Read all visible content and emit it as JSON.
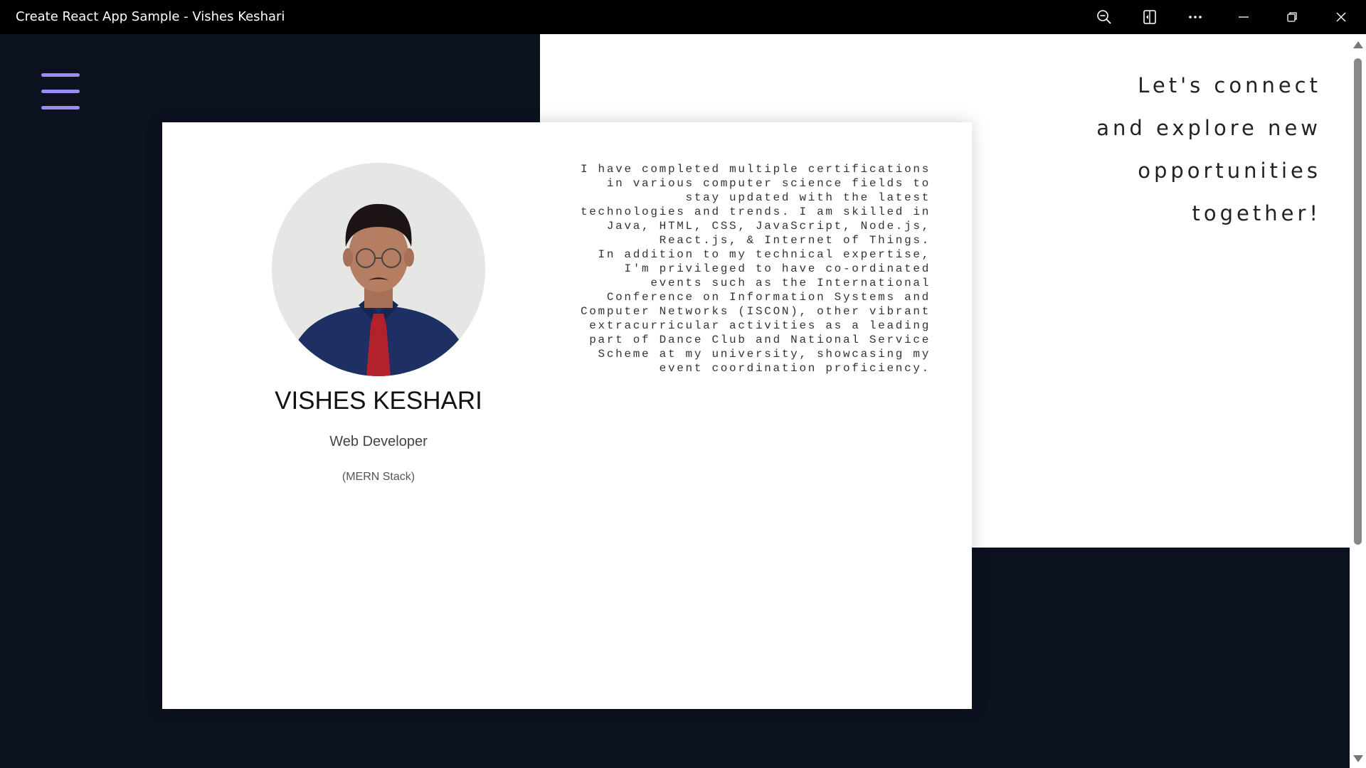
{
  "window": {
    "title": "Create React App Sample - Vishes Keshari",
    "controls": [
      "zoom-out-icon",
      "immersive-reader-icon",
      "more-icon",
      "minimize-icon",
      "restore-icon",
      "close-icon"
    ]
  },
  "nav": {
    "menu_icon": "hamburger-icon",
    "accent_color": "#9b8cf2"
  },
  "connect": {
    "lines": [
      "Let's connect",
      "and explore new",
      "opportunities",
      "together!"
    ]
  },
  "profile": {
    "name": "VISHES KESHARI",
    "role": "Web Developer",
    "stack": "(MERN Stack)",
    "bio": [
      "I have completed multiple certifications in various computer science fields to stay updated with the latest technologies and trends. I am skilled in Java, HTML, CSS, JavaScript, Node.js, React.js, & Internet of Things.",
      "In addition to my technical expertise, I'm privileged to have co-ordinated events such as the International Conference on Information Systems and Computer Networks (ISCON), other vibrant extracurricular activities as a leading part of Dance Club and National Service Scheme at my university, showcasing my event coordination proficiency."
    ]
  },
  "colors": {
    "background": "#0c1120",
    "panel": "#ffffff",
    "titlebar": "#000000"
  }
}
